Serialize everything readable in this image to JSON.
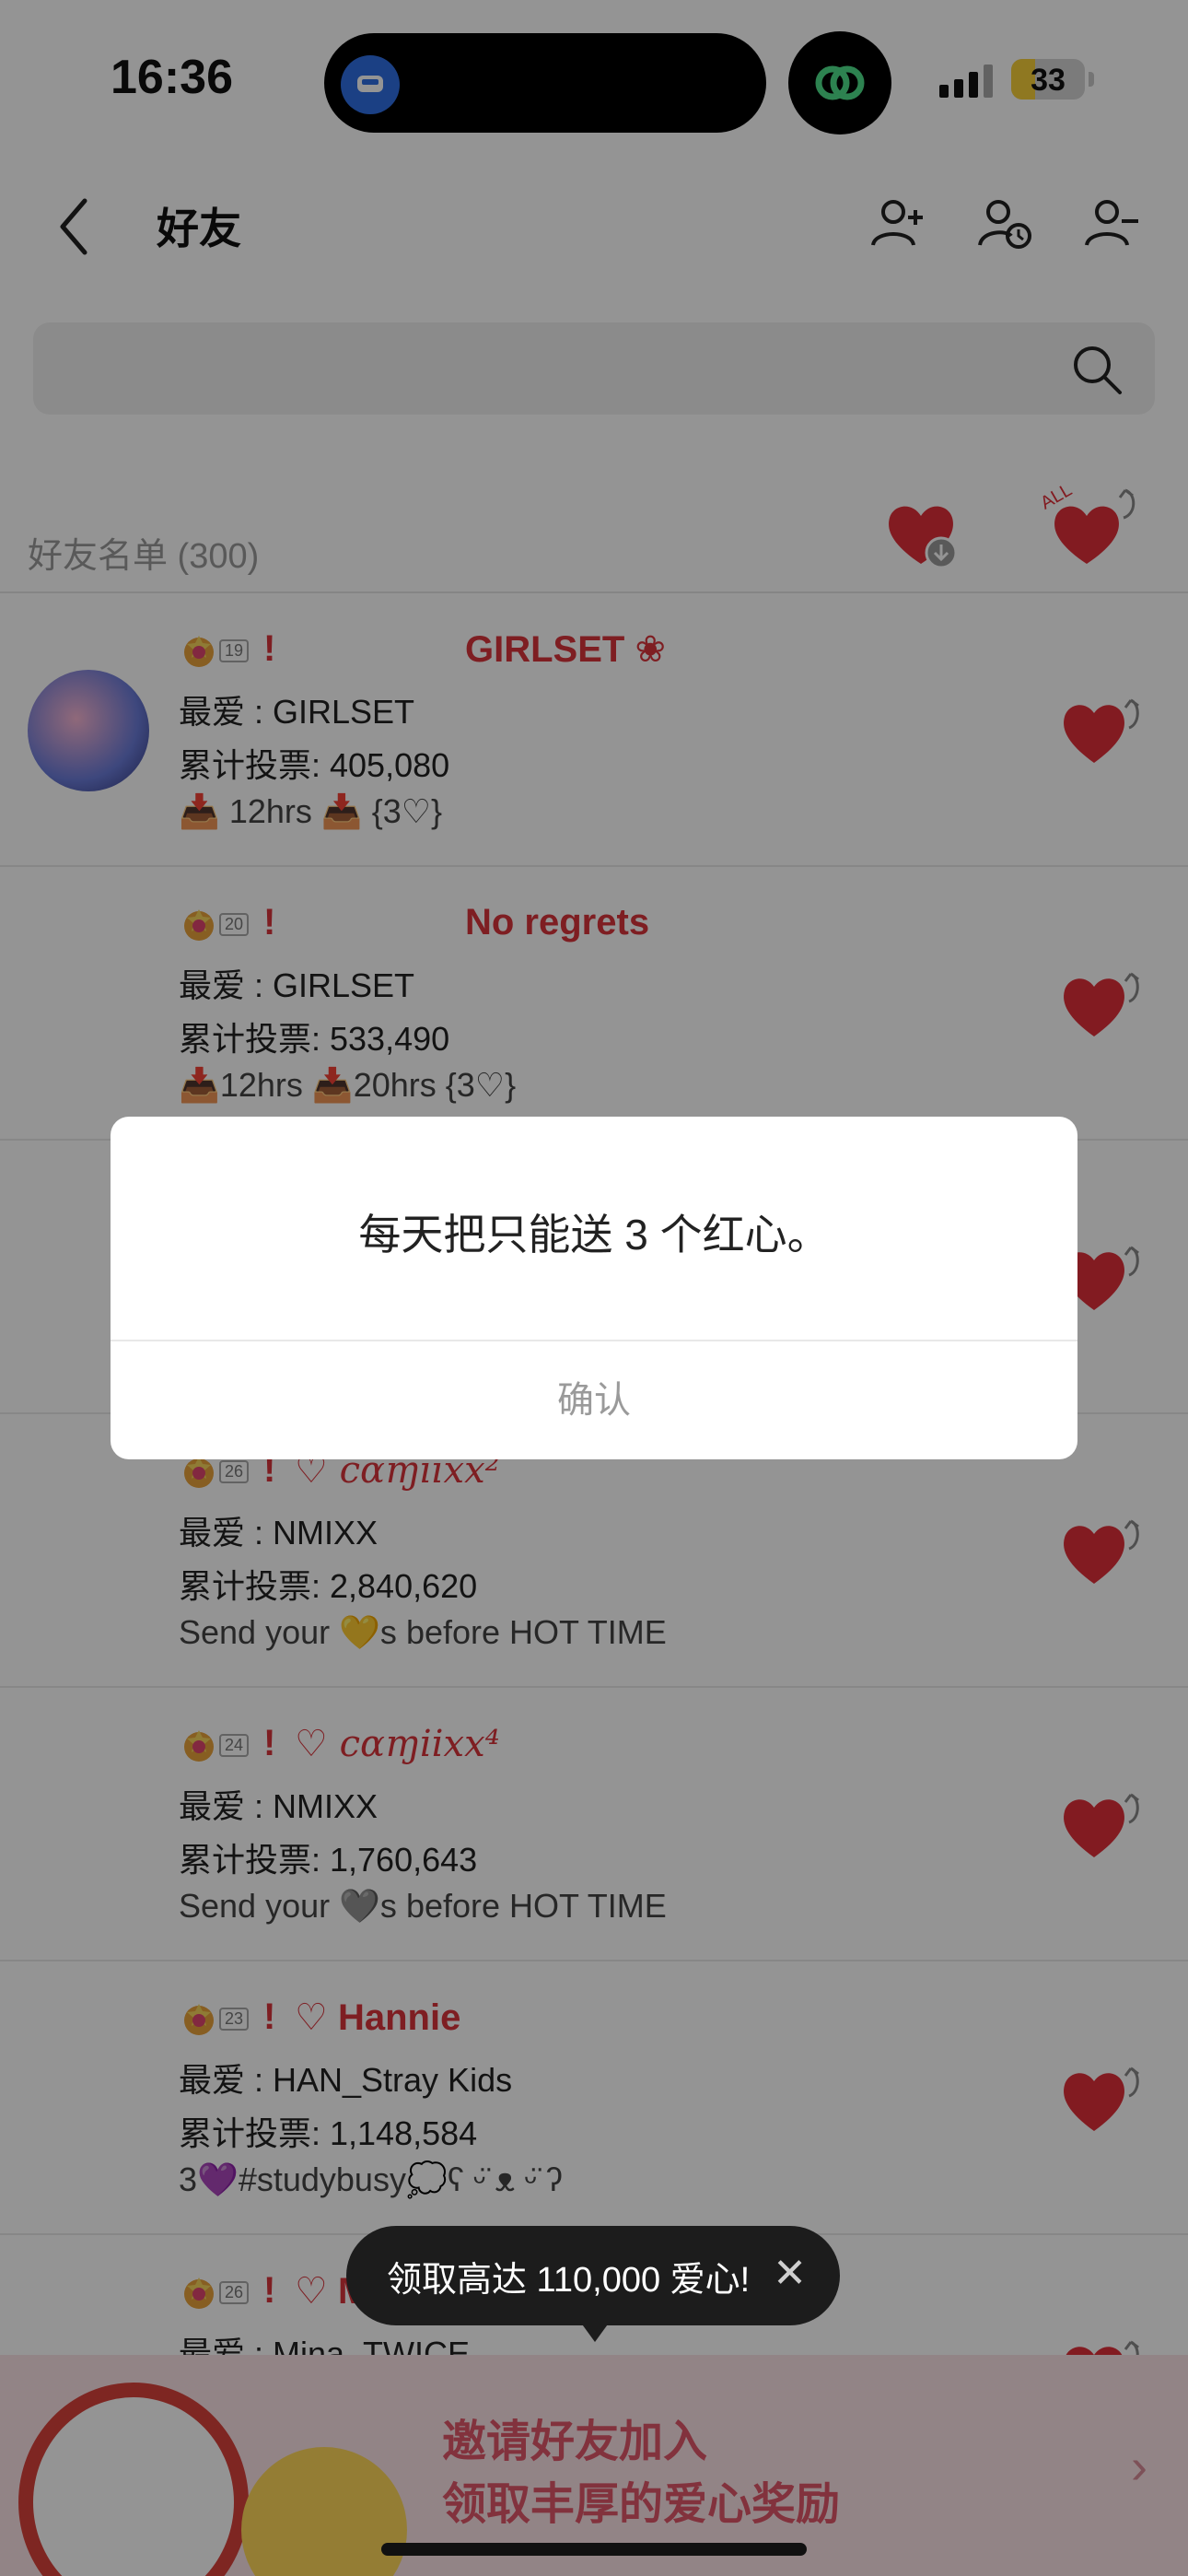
{
  "status": {
    "time": "16:36",
    "battery": "33",
    "battery_fill": 0.33
  },
  "header": {
    "title": "好友"
  },
  "search": {
    "placeholder": ""
  },
  "list": {
    "heading": "好友名单 (300)"
  },
  "colors": {
    "accent": "#d9343c",
    "heart": "#e0303a"
  },
  "friends": [
    {
      "level": "19",
      "name": "GIRLSET ❀",
      "fav": "最爱 : GIRLSET",
      "votes": "累计投票: 405,080",
      "line3": "📥 12hrs   📥   {3♡}",
      "name_script": false
    },
    {
      "level": "20",
      "name": "No regrets",
      "fav": "最爱 : GIRLSET",
      "votes": "累计投票: 533,490",
      "line3": "📥12hrs  📥20hrs  {3♡}",
      "name_script": false
    },
    {
      "level": "",
      "name": "",
      "fav": "",
      "votes": "",
      "line3": "",
      "name_script": false
    },
    {
      "level": "26",
      "name": "♡  cɑɱⅱxx²",
      "fav": "最爱 : NMIXX",
      "votes": "累计投票: 2,840,620",
      "line3": "Send your 💛s before HOT TIME",
      "name_script": true
    },
    {
      "level": "24",
      "name": "♡  cɑɱⅱxx⁴",
      "fav": "最爱 : NMIXX",
      "votes": "累计投票: 1,760,643",
      "line3": "Send your 🩶s before HOT TIME",
      "name_script": true
    },
    {
      "level": "23",
      "name": "♡ Hannie",
      "fav": "最爱 : HAN_Stray Kids",
      "votes": "累计投票: 1,148,584",
      "line3": "3💜#studybusy💭ʕ ᵕ̈ ᴥ ᵕ̈ ʔ",
      "name_script": false
    },
    {
      "level": "26",
      "name": "♡ M",
      "fav": "最爱 : Mina_TWICE",
      "votes": "",
      "line3": "",
      "name_script": false
    }
  ],
  "tooltip": {
    "text": "领取高达 110,000 爱心!",
    "close": "✕"
  },
  "banner": {
    "line1": "邀请好友加入",
    "line2": "领取丰厚的爱心奖励",
    "chevron": "›"
  },
  "dialog": {
    "message": "每天把只能送 3 个红心。",
    "confirm": "确认"
  }
}
